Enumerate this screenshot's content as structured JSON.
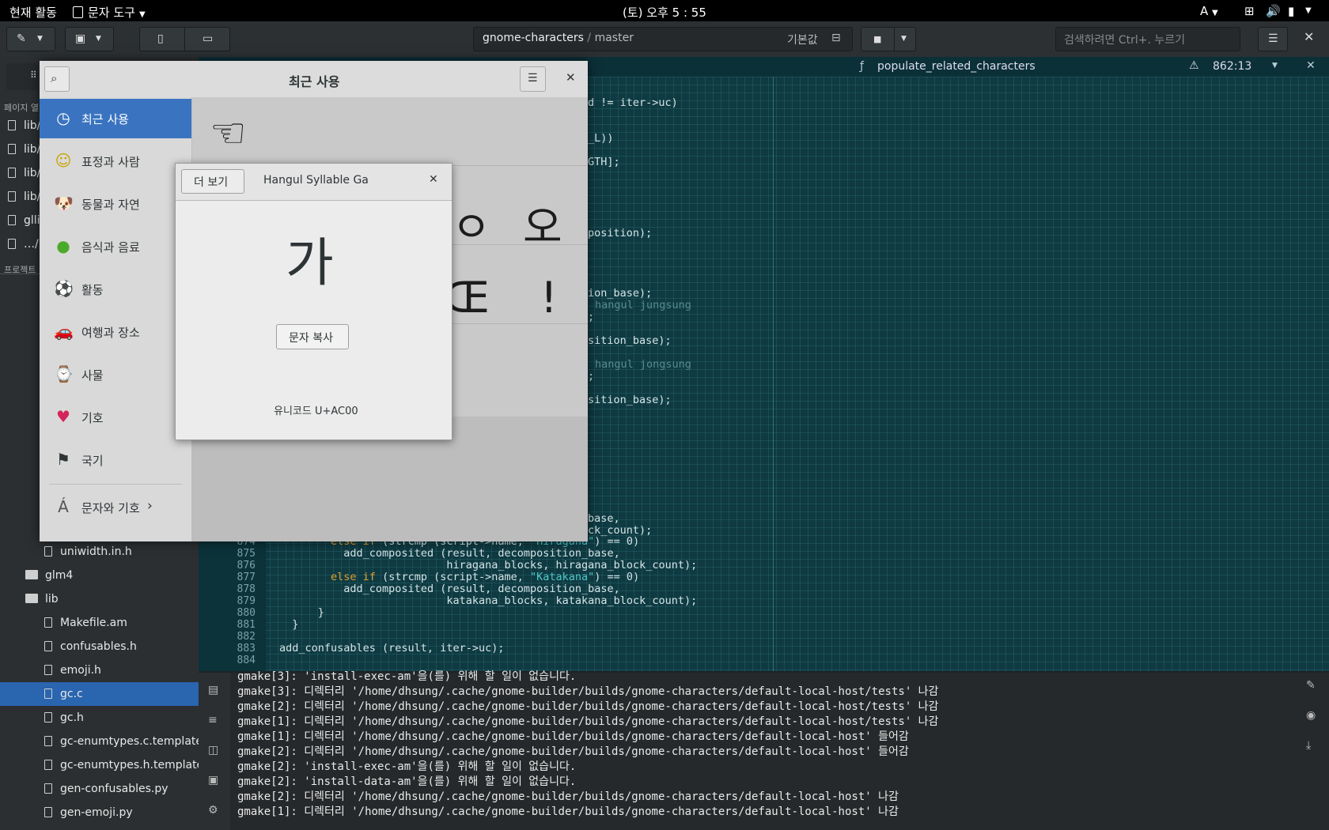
{
  "topbar": {
    "activities": "현재 활동",
    "app_menu": "문자 도구",
    "clock": "(토) 오후 5 : 55",
    "input_method": "A"
  },
  "header": {
    "project": "gnome-characters",
    "branch": "master",
    "config": "기본값",
    "search_placeholder": "검색하려면 Ctrl+. 누르기"
  },
  "editor_tab": {
    "symbol": "populate_related_characters",
    "position": "862:13"
  },
  "sidebar": {
    "section_open": "페이지 열",
    "open_items": [
      "lib/",
      "lib/",
      "lib/",
      "lib/",
      "glli",
      "…/"
    ],
    "section_project": "프로젝트",
    "tree": [
      {
        "label": "uniwidth.in.h",
        "type": "file",
        "indent": 1
      },
      {
        "label": "glm4",
        "type": "folder",
        "indent": 0
      },
      {
        "label": "lib",
        "type": "folder",
        "indent": 0
      },
      {
        "label": "Makefile.am",
        "type": "file",
        "indent": 1
      },
      {
        "label": "confusables.h",
        "type": "file",
        "indent": 1
      },
      {
        "label": "emoji.h",
        "type": "file",
        "indent": 1
      },
      {
        "label": "gc.c",
        "type": "file",
        "indent": 1,
        "selected": true
      },
      {
        "label": "gc.h",
        "type": "file",
        "indent": 1
      },
      {
        "label": "gc-enumtypes.c.template",
        "type": "file",
        "indent": 1
      },
      {
        "label": "gc-enumtypes.h.template",
        "type": "file",
        "indent": 1
      },
      {
        "label": "gen-confusables.py",
        "type": "file",
        "indent": 1
      },
      {
        "label": "gen-emoji.py",
        "type": "file",
        "indent": 1
      }
    ]
  },
  "code_fragments": {
    "l1": "d != iter->uc)",
    "l2": "_L))",
    "l3": "GTH];",
    "l4": "position);",
    "l5": "ion_base);",
    "l5c": "hangul jungsung",
    "l6": ";",
    "l7": "sition_base);",
    "l8c": "hangul jongsung",
    "l9": ";",
    "l10": "sition_base);",
    "l11": "base,",
    "l12": "ck_count);"
  },
  "code_lines": [
    {
      "n": "874",
      "kw": "else if",
      "pre": " (strcmp (script->name, ",
      "str": "\"Hiragana\"",
      "post": ") == 0)",
      "indent": "        "
    },
    {
      "n": "875",
      "kw": "",
      "pre": "add_composited (result, decomposition_base,",
      "str": "",
      "post": "",
      "indent": "          "
    },
    {
      "n": "876",
      "kw": "",
      "pre": "hiragana_blocks, hiragana_block_count);",
      "str": "",
      "post": "",
      "indent": "                          "
    },
    {
      "n": "877",
      "kw": "else if",
      "pre": " (strcmp (script->name, ",
      "str": "\"Katakana\"",
      "post": ") == 0)",
      "indent": "        "
    },
    {
      "n": "878",
      "kw": "",
      "pre": "add_composited (result, decomposition_base,",
      "str": "",
      "post": "",
      "indent": "          "
    },
    {
      "n": "879",
      "kw": "",
      "pre": "katakana_blocks, katakana_block_count);",
      "str": "",
      "post": "",
      "indent": "                          "
    },
    {
      "n": "880",
      "kw": "",
      "pre": "}",
      "str": "",
      "post": "",
      "indent": "      "
    },
    {
      "n": "881",
      "kw": "",
      "pre": "}",
      "str": "",
      "post": "",
      "indent": "  "
    },
    {
      "n": "882",
      "kw": "",
      "pre": "",
      "str": "",
      "post": "",
      "indent": ""
    },
    {
      "n": "883",
      "kw": "",
      "pre": "add_confusables (result, iter->uc);",
      "str": "",
      "post": "",
      "indent": ""
    },
    {
      "n": "884",
      "kw": "",
      "pre": "",
      "str": "",
      "post": "",
      "indent": ""
    }
  ],
  "terminal": [
    "gmake[3]: 'install-exec-am'을(를) 위해 할 일이 없습니다.",
    "gmake[3]: 디렉터리 '/home/dhsung/.cache/gnome-builder/builds/gnome-characters/default-local-host/tests' 나감",
    "gmake[2]: 디렉터리 '/home/dhsung/.cache/gnome-builder/builds/gnome-characters/default-local-host/tests' 나감",
    "gmake[1]: 디렉터리 '/home/dhsung/.cache/gnome-builder/builds/gnome-characters/default-local-host/tests' 나감",
    "gmake[1]: 디렉터리 '/home/dhsung/.cache/gnome-builder/builds/gnome-characters/default-local-host' 들어감",
    "gmake[2]: 디렉터리 '/home/dhsung/.cache/gnome-builder/builds/gnome-characters/default-local-host' 들어감",
    "gmake[2]: 'install-exec-am'을(를) 위해 할 일이 없습니다.",
    "gmake[2]: 'install-data-am'을(를) 위해 할 일이 없습니다.",
    "gmake[2]: 디렉터리 '/home/dhsung/.cache/gnome-builder/builds/gnome-characters/default-local-host' 나감",
    "gmake[1]: 디렉터리 '/home/dhsung/.cache/gnome-builder/builds/gnome-characters/default-local-host' 나감"
  ],
  "characters": {
    "title": "최근 사용",
    "categories": [
      {
        "label": "최근 사용",
        "icon": "clock-icon",
        "glyph": "◷",
        "selected": true
      },
      {
        "label": "표정과 사람",
        "icon": "smiley-icon",
        "glyph": "☺"
      },
      {
        "label": "동물과 자연",
        "icon": "dog-icon",
        "glyph": "🐶"
      },
      {
        "label": "음식과 음료",
        "icon": "apple-icon",
        "glyph": "●"
      },
      {
        "label": "활동",
        "icon": "soccer-icon",
        "glyph": "⚽"
      },
      {
        "label": "여행과 장소",
        "icon": "car-icon",
        "glyph": "🚗"
      },
      {
        "label": "사물",
        "icon": "watch-icon",
        "glyph": "⌚"
      },
      {
        "label": "기호",
        "icon": "heart-icon",
        "glyph": "♥"
      },
      {
        "label": "국기",
        "icon": "checkered-flag-icon",
        "glyph": "⚑"
      }
    ],
    "more_category": "문자와 기호",
    "more_glyph": "Á",
    "grid_glyphs": [
      "☜",
      "ㅇ",
      "오",
      "Œ",
      "!"
    ]
  },
  "dialog": {
    "more_button": "더 보기",
    "title": "Hangul Syllable Ga",
    "glyph": "가",
    "copy_button": "문자 복사",
    "codepoint": "유니코드 U+AC00"
  }
}
